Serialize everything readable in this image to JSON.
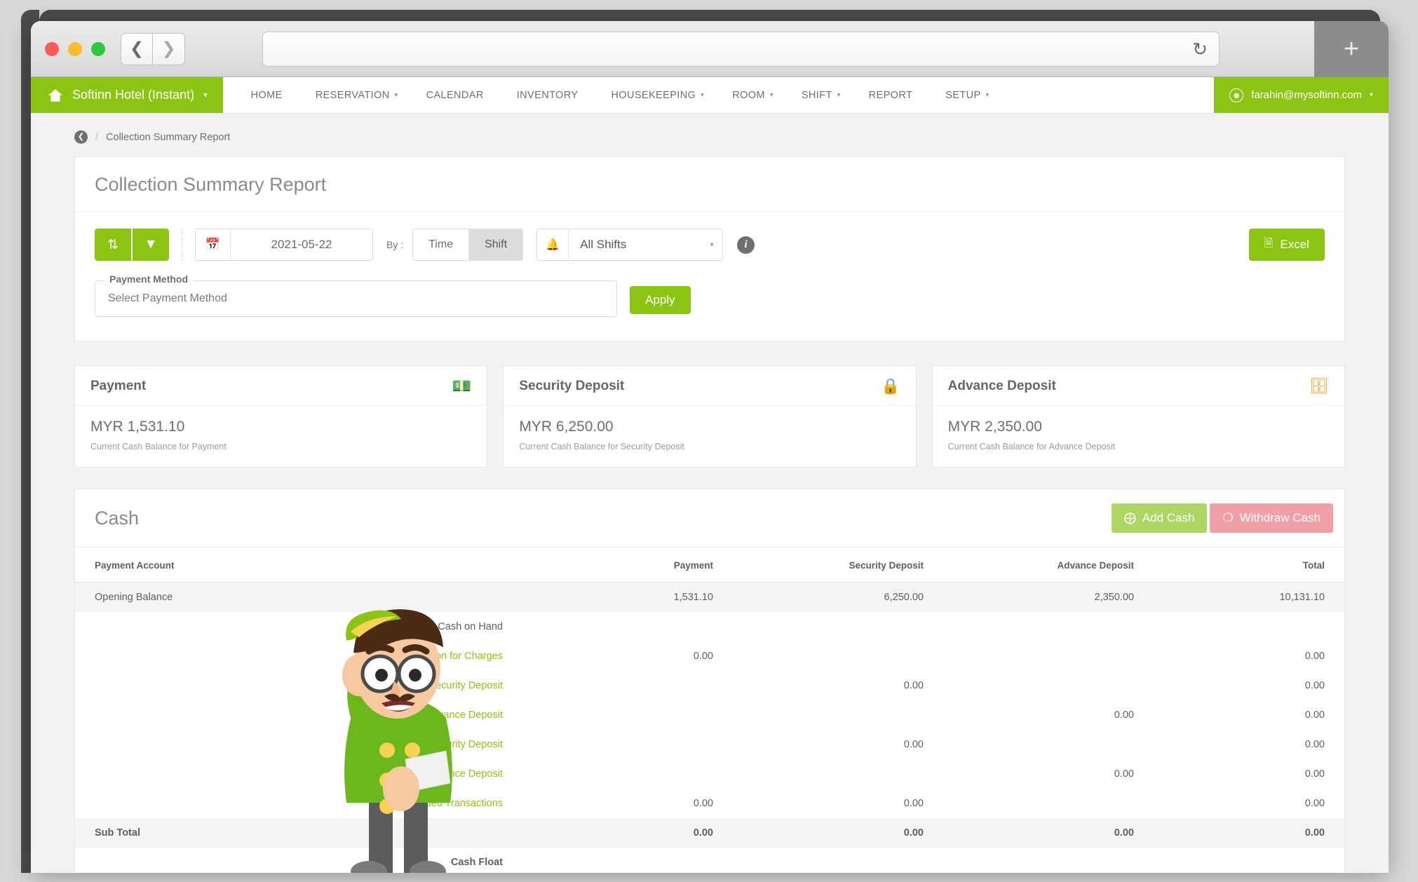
{
  "browser": {
    "url_value": "",
    "url_placeholder": "",
    "back_icon": "chevron-left-icon",
    "forward_icon": "chevron-right-icon",
    "reload_icon": "reload-icon",
    "newtab_label": "+"
  },
  "appnav": {
    "brand": "Softinn Hotel (Instant)",
    "brand_caret": "▾",
    "home_icon": "home-icon",
    "menu": [
      {
        "label": "HOME",
        "caret": ""
      },
      {
        "label": "RESERVATION",
        "caret": "▾"
      },
      {
        "label": "CALENDAR",
        "caret": ""
      },
      {
        "label": "INVENTORY",
        "caret": ""
      },
      {
        "label": "HOUSEKEEPING",
        "caret": "▾"
      },
      {
        "label": "ROOM",
        "caret": "▾"
      },
      {
        "label": "SHIFT",
        "caret": "▾"
      },
      {
        "label": "REPORT",
        "caret": ""
      },
      {
        "label": "SETUP",
        "caret": "▾"
      }
    ],
    "account": "farahin@mysoftinn.com",
    "account_caret": "▾"
  },
  "breadcrumb": {
    "back_icon": "back-circle-icon",
    "separator": "/",
    "current": "Collection Summary Report"
  },
  "report": {
    "title": "Collection Summary Report",
    "refresh_icon": "refresh-icon",
    "filter_icon": "funnel-icon",
    "calendar_icon": "calendar-icon",
    "date_value": "2021-05-22",
    "by_label": "By :",
    "toggle": [
      {
        "label": "Time",
        "active": false
      },
      {
        "label": "Shift",
        "active": true
      }
    ],
    "bell_icon": "bell-icon",
    "shift_value": "All Shifts",
    "shift_caret": "▾",
    "info_icon": "info-icon",
    "excel_label": "Excel",
    "excel_icon": "excel-file-icon",
    "payment_method_legend": "Payment Method",
    "payment_method_placeholder": "Select Payment Method",
    "apply_label": "Apply"
  },
  "cards": [
    {
      "title": "Payment",
      "amount": "MYR 1,531.10",
      "subtitle": "Current Cash Balance for Payment",
      "icon": "money-icon",
      "icon_color": "#8cc413"
    },
    {
      "title": "Security Deposit",
      "amount": "MYR 6,250.00",
      "subtitle": "Current Cash Balance for Security Deposit",
      "icon": "lock-icon",
      "icon_color": "#e8636f"
    },
    {
      "title": "Advance Deposit",
      "amount": "MYR 2,350.00",
      "subtitle": "Current Cash Balance for Advance Deposit",
      "icon": "wallet-icon",
      "icon_color": "#f7a13d"
    }
  ],
  "cash": {
    "title": "Cash",
    "add_label": "Add Cash",
    "add_icon": "plus-circle-icon",
    "withdraw_label": "Withdraw Cash",
    "withdraw_icon": "minus-circle-icon",
    "columns": [
      "Payment Account",
      "Payment",
      "Security Deposit",
      "Advance Deposit",
      "Total"
    ],
    "rows": [
      {
        "label": "Opening Balance",
        "payment": "1,531.10",
        "security": "6,250.00",
        "advance": "2,350.00",
        "total": "10,131.10",
        "style": "shaded",
        "indent": false
      },
      {
        "label": "Cash on Hand",
        "payment": "",
        "security": "",
        "advance": "",
        "total": "",
        "style": "group",
        "indent": false
      },
      {
        "label": "Collection for Charges",
        "payment": "0.00",
        "security": "",
        "advance": "",
        "total": "0.00",
        "style": "link",
        "indent": true
      },
      {
        "label": "Collection for Security Deposit",
        "payment": "",
        "security": "0.00",
        "advance": "",
        "total": "0.00",
        "style": "link",
        "indent": true
      },
      {
        "label": "Collection for Advance Deposit",
        "payment": "",
        "security": "",
        "advance": "0.00",
        "total": "0.00",
        "style": "link",
        "indent": true
      },
      {
        "label": "Refund for Security Deposit",
        "payment": "",
        "security": "0.00",
        "advance": "",
        "total": "0.00",
        "style": "link",
        "indent": true
      },
      {
        "label": "Refund for Advance Deposit",
        "payment": "",
        "security": "",
        "advance": "0.00",
        "total": "0.00",
        "style": "link",
        "indent": true
      },
      {
        "label": "Voided Transactions",
        "payment": "0.00",
        "security": "0.00",
        "advance": "",
        "total": "0.00",
        "style": "link",
        "indent": true
      },
      {
        "label": "Sub Total",
        "payment": "0.00",
        "security": "0.00",
        "advance": "0.00",
        "total": "0.00",
        "style": "shaded",
        "indent": false
      },
      {
        "label": "Cash Float",
        "payment": "",
        "security": "",
        "advance": "",
        "total": "",
        "style": "group-bold",
        "indent": false
      }
    ]
  },
  "colors": {
    "brand_green": "#8cc413",
    "link_green": "#8cc413",
    "danger_pink": "#f2a0a8",
    "light_green": "#aed665"
  }
}
